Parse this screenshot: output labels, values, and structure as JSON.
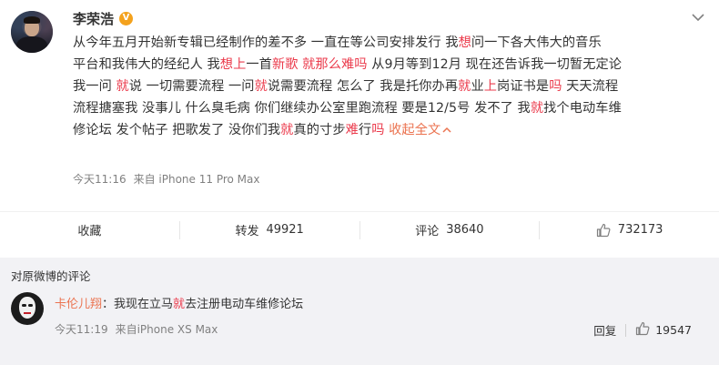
{
  "post": {
    "author_name": "李荣浩",
    "verified_badge": "V",
    "content": {
      "line1": [
        {
          "t": "从今年五月开始新专辑已经制作的差不多 一直在等公司安排发行 我"
        },
        {
          "t": "想",
          "hl": true
        },
        {
          "t": "问一下各大伟大的音乐"
        }
      ],
      "line2": [
        {
          "t": "平台和我伟大的经纪人 我"
        },
        {
          "t": "想上",
          "hl": true
        },
        {
          "t": "一首"
        },
        {
          "t": "新歌",
          "hl": true
        },
        {
          "t": " "
        },
        {
          "t": "就那么难吗",
          "hl": true
        },
        {
          "t": " 从9月等到12月 现在还告诉我一切暂无定论"
        }
      ],
      "line3": [
        {
          "t": "我一问 "
        },
        {
          "t": "就",
          "hl": true
        },
        {
          "t": "说 一切需要流程 一问"
        },
        {
          "t": "就",
          "hl": true
        },
        {
          "t": "说需要流程 怎么了 我是托你办再"
        },
        {
          "t": "就",
          "hl": true
        },
        {
          "t": "业"
        },
        {
          "t": "上",
          "hl": true
        },
        {
          "t": "岗证书是"
        },
        {
          "t": "吗",
          "hl": true
        },
        {
          "t": " 天天流程"
        }
      ],
      "line4": [
        {
          "t": "流程搪塞我 没事儿 什么臭毛病 你们继续办公室里跑流程 要是12/5号 发不了 我"
        },
        {
          "t": "就",
          "hl": true
        },
        {
          "t": "找个电动车维"
        }
      ],
      "line5": [
        {
          "t": "修论坛 发个帖子 把歌发了 没你们我"
        },
        {
          "t": "就",
          "hl": true
        },
        {
          "t": "真的寸步"
        },
        {
          "t": "难",
          "hl": true
        },
        {
          "t": "行"
        },
        {
          "t": "吗",
          "hl": true
        },
        {
          "t": " "
        }
      ],
      "collapse_label": "收起全文"
    },
    "time": "今天11:16",
    "source": "来自 iPhone 11 Pro Max"
  },
  "actions": {
    "favorite_label": "收藏",
    "repost_label": "转发",
    "repost_count": "49921",
    "comment_label": "评论",
    "comment_count": "38640",
    "like_count": "732173"
  },
  "comments": {
    "title": "对原微博的评论",
    "items": [
      {
        "user": "卡伦儿翔",
        "separator": "：",
        "text_parts": [
          {
            "t": "我现在立马"
          },
          {
            "t": "就",
            "hl": true
          },
          {
            "t": "去注册电动车维修论坛"
          }
        ],
        "time": "今天11:19",
        "source": "来自iPhone XS Max",
        "reply_label": "回复",
        "like_count": "19547"
      }
    ]
  },
  "colors": {
    "highlight": "#eb3b4c",
    "link": "#eb7350",
    "meta_gray": "#808080",
    "comment_bg": "#f2f2f5",
    "badge": "#f4a21d"
  },
  "icons": {
    "menu": "chevron-down-icon",
    "like": "thumbs-up-icon",
    "collapse": "chevron-up-icon",
    "verified": "verified-v-icon"
  }
}
